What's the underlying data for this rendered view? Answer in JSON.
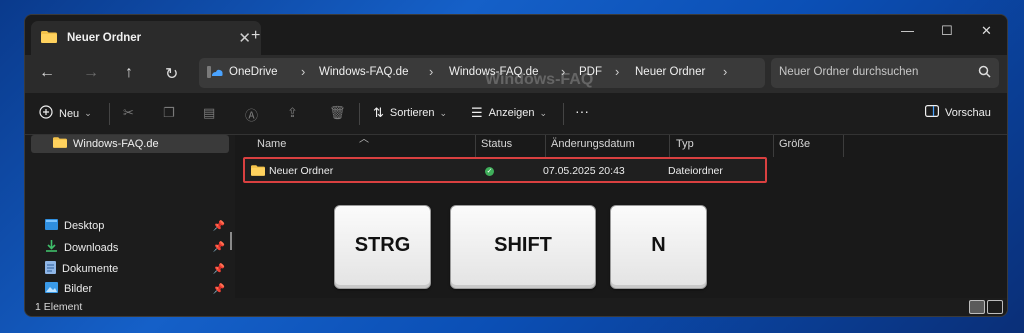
{
  "tab": {
    "title": "Neuer Ordner",
    "close": "✕",
    "new_tab": "+"
  },
  "window_controls": {
    "minimize": "—",
    "maximize": "☐",
    "close": "✕"
  },
  "nav": {
    "back": "←",
    "forward": "→",
    "up": "↑",
    "refresh": "↻",
    "breadcrumbs": [
      "OneDrive",
      "Windows-FAQ.de",
      "Windows-FAQ.de",
      "PDF",
      "Neuer Ordner"
    ],
    "separator": "›",
    "search_placeholder": "Neuer Ordner durchsuchen"
  },
  "toolbar": {
    "new_label": "Neu",
    "sort_label": "Sortieren",
    "view_label": "Anzeigen",
    "more": "···",
    "preview_label": "Vorschau"
  },
  "sidebar": {
    "selected": "Windows-FAQ.de",
    "quick_access": [
      "Desktop",
      "Downloads",
      "Dokumente",
      "Bilder"
    ]
  },
  "columns": [
    "Name",
    "Status",
    "Änderungsdatum",
    "Typ",
    "Größe"
  ],
  "rows": [
    {
      "name": "Neuer Ordner",
      "status": "synced",
      "modified": "07.05.2025 20:43",
      "type": "Dateiordner",
      "size": ""
    }
  ],
  "watermark": "Windows-FAQ",
  "keys": [
    "STRG",
    "SHIFT",
    "N"
  ],
  "status_bar": {
    "item_count": "1 Element"
  },
  "colors": {
    "folder": "#f3c24a",
    "highlight_border": "#d94040",
    "status_ok": "#3fae5a",
    "accent": "#4aa3ff"
  }
}
